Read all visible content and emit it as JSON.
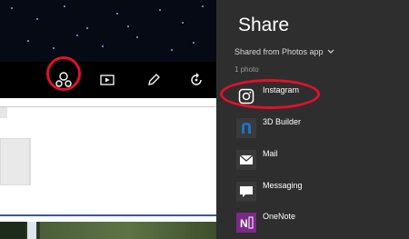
{
  "share_pane": {
    "title": "Share",
    "source_label": "Shared from Photos app",
    "count_label": "1 photo",
    "apps": [
      {
        "label": "Instagram",
        "icon": "instagram-icon"
      },
      {
        "label": "3D Builder",
        "icon": "3d-builder-icon"
      },
      {
        "label": "Mail",
        "icon": "mail-icon"
      },
      {
        "label": "Messaging",
        "icon": "messaging-icon"
      },
      {
        "label": "OneNote",
        "icon": "onenote-icon"
      }
    ]
  },
  "toolbar": {
    "buttons": [
      "share-icon",
      "slideshow-icon",
      "edit-icon",
      "rotate-icon"
    ]
  },
  "colors": {
    "highlight": "#e3102a",
    "pane_bg": "#2e2e2e",
    "onenote": "#7a2a86",
    "builder": "#1b73c9"
  }
}
